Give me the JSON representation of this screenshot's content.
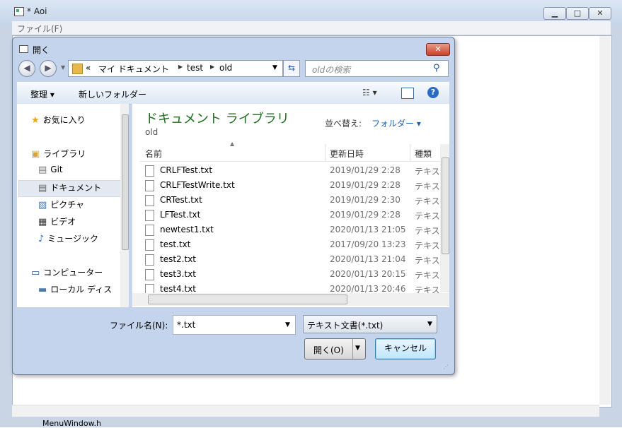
{
  "app": {
    "title": "* Aoi",
    "minimize": "▁",
    "maximize": "□",
    "close": "✕",
    "menu_file": "ファイル(F)",
    "bottom_item": "MenuWindow.h"
  },
  "dialog": {
    "title": "開く",
    "close": "✕",
    "nav_back": "◀",
    "nav_forward": "▶",
    "breadcrumb": {
      "overflow": "«",
      "items": [
        "マイ ドキュメント",
        "test",
        "old"
      ]
    },
    "search_placeholder": "oldの検索",
    "toolbar": {
      "organize": "整理 ▾",
      "new_folder": "新しいフォルダー",
      "view": "☷ ▾",
      "help": "?"
    },
    "nav_pane": [
      {
        "label": "お気に入り",
        "icon": "star-icon",
        "glyph": "★"
      },
      {
        "label": "ライブラリ",
        "icon": "library-icon",
        "glyph": "▣"
      },
      {
        "label": "Git",
        "icon": "git-doc-icon",
        "glyph": "▤"
      },
      {
        "label": "ドキュメント",
        "icon": "document-icon",
        "glyph": "▤"
      },
      {
        "label": "ピクチャ",
        "icon": "picture-icon",
        "glyph": "▨"
      },
      {
        "label": "ビデオ",
        "icon": "video-icon",
        "glyph": "▦"
      },
      {
        "label": "ミュージック",
        "icon": "music-icon",
        "glyph": "♪"
      },
      {
        "label": "コンピューター",
        "icon": "computer-icon",
        "glyph": "▭"
      },
      {
        "label": "ローカル ディス",
        "icon": "disk-icon",
        "glyph": "▬"
      }
    ],
    "library": {
      "title": "ドキュメント ライブラリ",
      "subtitle": "old",
      "sort_label": "並べ替え:",
      "sort_value": "フォルダー ▾"
    },
    "columns": [
      "名前",
      "更新日時",
      "種類"
    ],
    "files": [
      {
        "name": "CRLFTest.txt",
        "date": "2019/01/29 2:28",
        "type": "テキスト"
      },
      {
        "name": "CRLFTestWrite.txt",
        "date": "2019/01/29 2:28",
        "type": "テキスト"
      },
      {
        "name": "CRTest.txt",
        "date": "2019/01/29 2:30",
        "type": "テキスト"
      },
      {
        "name": "LFTest.txt",
        "date": "2019/01/29 2:28",
        "type": "テキスト"
      },
      {
        "name": "newtest1.txt",
        "date": "2020/01/13 21:05",
        "type": "テキスト"
      },
      {
        "name": "test.txt",
        "date": "2017/09/20 13:23",
        "type": "テキスト"
      },
      {
        "name": "test2.txt",
        "date": "2020/01/13 21:04",
        "type": "テキスト"
      },
      {
        "name": "test3.txt",
        "date": "2020/01/13 20:15",
        "type": "テキスト"
      },
      {
        "name": "test4.txt",
        "date": "2020/01/13 20:46",
        "type": "テキスト"
      }
    ],
    "filename_label": "ファイル名(N):",
    "filename_value": "*.txt",
    "filter_value": "テキスト文書(*.txt)",
    "open_label": "開く(O)",
    "cancel_label": "キャンセル"
  }
}
